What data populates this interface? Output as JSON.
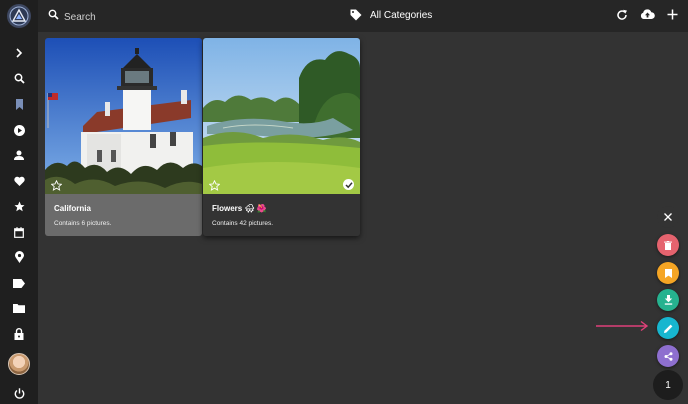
{
  "search": {
    "placeholder": "Search"
  },
  "header": {
    "category_label": "All Categories"
  },
  "albums": [
    {
      "title": "California",
      "description": "Contains 6 pictures."
    },
    {
      "title": "Flowers 🌨 🌺",
      "description": "Contains 42 pictures."
    }
  ],
  "selection": {
    "count": "1"
  },
  "colors": {
    "delete": "#e5636e",
    "bookmark": "#f5a524",
    "download": "#26b28f",
    "edit": "#17b6cf",
    "share": "#8e6fcf",
    "arrow": "#e0407a"
  },
  "icons": {
    "sidebar": [
      "chevron-right-icon",
      "search-icon",
      "bookmark-icon",
      "play-icon",
      "person-icon",
      "heart-icon",
      "star-icon",
      "calendar-icon",
      "place-icon",
      "label-icon",
      "folder-icon",
      "lock-icon",
      "avatar",
      "power-icon"
    ],
    "fabs": [
      "close-icon",
      "delete-icon",
      "bookmark-icon",
      "download-icon",
      "edit-icon",
      "share-icon"
    ]
  }
}
